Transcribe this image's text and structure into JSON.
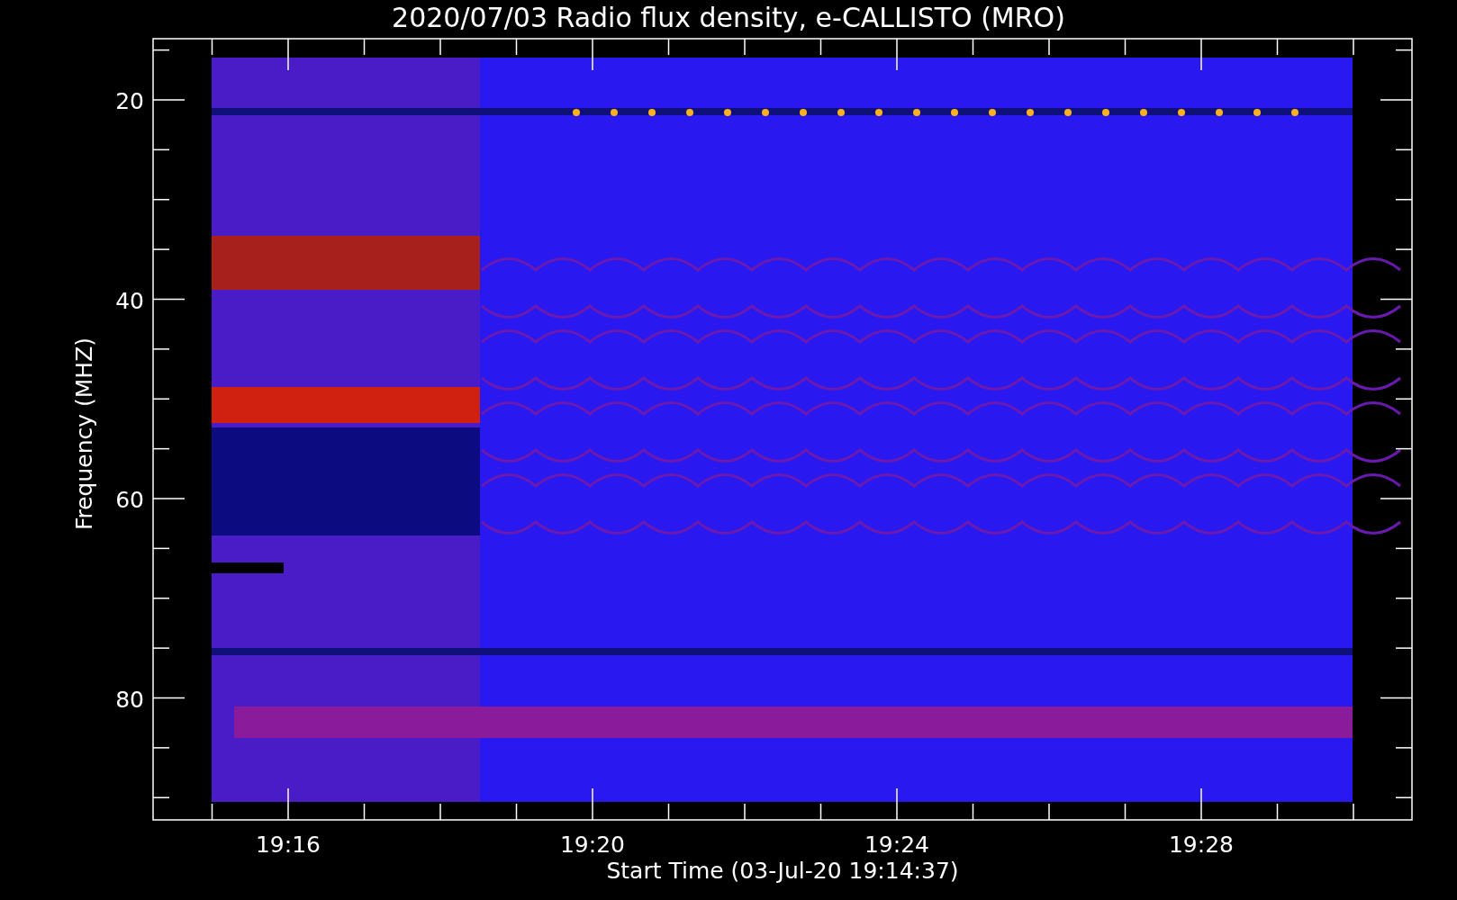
{
  "title": "2020/07/03  Radio flux density, e-CALLISTO (MRO)",
  "y_axis": {
    "label": "Frequency (MHZ)",
    "ticks": [
      "20",
      "40",
      "60",
      "80"
    ]
  },
  "x_axis": {
    "label": "Start Time (03-Jul-20 19:14:37)",
    "ticks": [
      "19:16",
      "19:20",
      "19:24",
      "19:28"
    ]
  }
}
